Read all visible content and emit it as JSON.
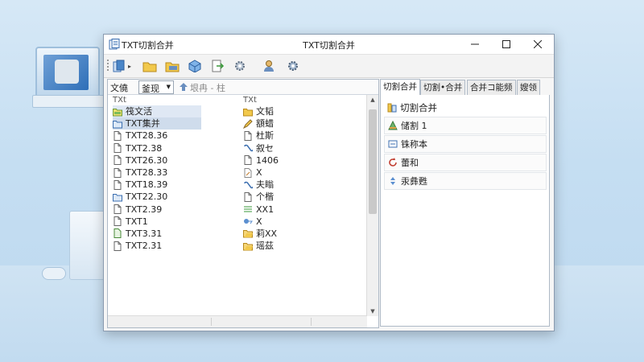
{
  "window": {
    "title": "TXT切割合并",
    "center_title": "TXT切割合并"
  },
  "pathbar": {
    "label": "文僥",
    "combo_value": "釜现",
    "path_text": "垠冉 - 柱"
  },
  "left_list": {
    "column1_header": "TXt",
    "column2_header": "TXt",
    "column1": [
      {
        "name": "筏文活",
        "icon": "folder-green-icon",
        "state": "selected"
      },
      {
        "name": "TXT集并",
        "icon": "folder-blue-icon",
        "state": "selected-strong"
      },
      {
        "name": "TXT28.36",
        "icon": "file-icon",
        "state": ""
      },
      {
        "name": "TXT2.38",
        "icon": "file-icon",
        "state": ""
      },
      {
        "name": "TXT26.30",
        "icon": "file-icon",
        "state": ""
      },
      {
        "name": "TXT28.33",
        "icon": "file-icon",
        "state": ""
      },
      {
        "name": "TXT18.39",
        "icon": "file-icon",
        "state": ""
      },
      {
        "name": "TXT22.30",
        "icon": "folder-blue-icon",
        "state": ""
      },
      {
        "name": "TXT2.39",
        "icon": "file-icon",
        "state": ""
      },
      {
        "name": "TXT1",
        "icon": "file-icon",
        "state": ""
      },
      {
        "name": "TXT3.31",
        "icon": "file-green-icon",
        "state": ""
      },
      {
        "name": "TXT2.31",
        "icon": "file-icon",
        "state": ""
      }
    ],
    "column2": [
      {
        "name": "文韬",
        "icon": "folder-icon"
      },
      {
        "name": "額蜡",
        "icon": "pencil-icon"
      },
      {
        "name": "杜斯",
        "icon": "file-icon"
      },
      {
        "name": "叙セ",
        "icon": "link-icon"
      },
      {
        "name": "1406",
        "icon": "file-icon"
      },
      {
        "name": "X",
        "icon": "file-edit-icon"
      },
      {
        "name": "夫瞈",
        "icon": "link-icon"
      },
      {
        "name": "个楷",
        "icon": "file-icon"
      },
      {
        "name": "XX1",
        "icon": "list-icon"
      },
      {
        "name": "X",
        "icon": "tag-icon"
      },
      {
        "name": "莉XX",
        "icon": "folder-open-icon"
      },
      {
        "name": "瑶茲",
        "icon": "folder-open-icon"
      }
    ]
  },
  "tabs": [
    {
      "label": "切割合并",
      "active": true
    },
    {
      "label": "切割•合并",
      "active": false
    },
    {
      "label": "合并コ能频",
      "active": false
    },
    {
      "label": "嫂领",
      "active": false
    }
  ],
  "actions": {
    "header": "切割合并",
    "items": [
      {
        "label": "储割 1",
        "icon": "triangle-icon"
      },
      {
        "label": "铢称本",
        "icon": "window-icon"
      },
      {
        "label": "蕾和",
        "icon": "refresh-icon"
      },
      {
        "label": "汞彝甦",
        "icon": "arrows-icon"
      }
    ]
  },
  "colors": {
    "accent": "#2f6fb8",
    "folder": "#f2c94c",
    "selection": "#cfdcec"
  }
}
